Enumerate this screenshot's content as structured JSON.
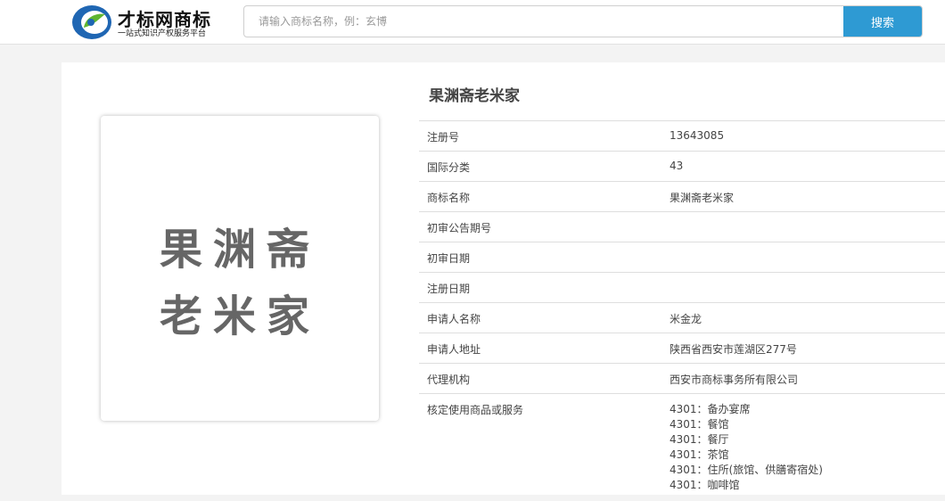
{
  "header": {
    "logo": {
      "title": "才标网商标",
      "subtitle": "一站式知识产权服务平台",
      "icon": "caibiao-logo-icon",
      "colors": {
        "blue": "#1f66b3",
        "green": "#5fb531"
      }
    },
    "search": {
      "placeholder": "请输入商标名称，例：玄博",
      "value": "",
      "button_label": "搜索",
      "button_color": "#2e9ad3"
    }
  },
  "trademark": {
    "name": "果渊斋老米家",
    "image_text": {
      "line1": "果渊斋",
      "line2": "老米家"
    },
    "fields": [
      {
        "label": "注册号",
        "value": "13643085"
      },
      {
        "label": "国际分类",
        "value": "43"
      },
      {
        "label": "商标名称",
        "value": "果渊斋老米家"
      },
      {
        "label": "初审公告期号",
        "value": ""
      },
      {
        "label": "初审日期",
        "value": ""
      },
      {
        "label": "注册日期",
        "value": ""
      },
      {
        "label": "申请人名称",
        "value": "米金龙"
      },
      {
        "label": "申请人地址",
        "value": "陕西省西安市莲湖区277号"
      },
      {
        "label": "代理机构",
        "value": "西安市商标事务所有限公司"
      }
    ],
    "services_label": "核定使用商品或服务",
    "services": [
      "4301：备办宴席",
      "4301：餐馆",
      "4301：餐厅",
      "4301：茶馆",
      "4301：住所(旅馆、供膳寄宿处)",
      "4301：咖啡馆"
    ]
  }
}
